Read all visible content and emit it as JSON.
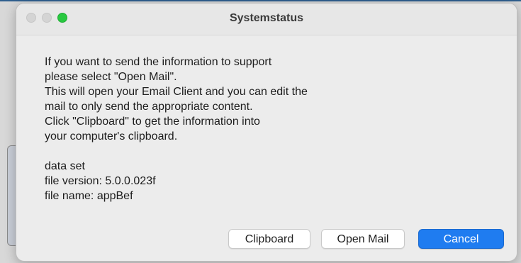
{
  "window": {
    "title": "Systemstatus"
  },
  "message": {
    "lines": [
      "If you want to send the information to support",
      "please select \"Open Mail\".",
      "This will open your Email Client and you can edit the",
      "mail to only send the appropriate content.",
      "Click \"Clipboard\" to get the information into",
      "your computer's clipboard."
    ],
    "details": [
      "data set",
      "file version: 5.0.0.023f",
      "file name: appBef"
    ]
  },
  "buttons": {
    "clipboard": "Clipboard",
    "open_mail": "Open Mail",
    "cancel": "Cancel"
  },
  "colors": {
    "primary_button": "#1f7cf0",
    "zoom_button": "#28c840"
  },
  "icons": {
    "close": "close-icon",
    "minimize": "minimize-icon",
    "zoom": "zoom-icon"
  }
}
